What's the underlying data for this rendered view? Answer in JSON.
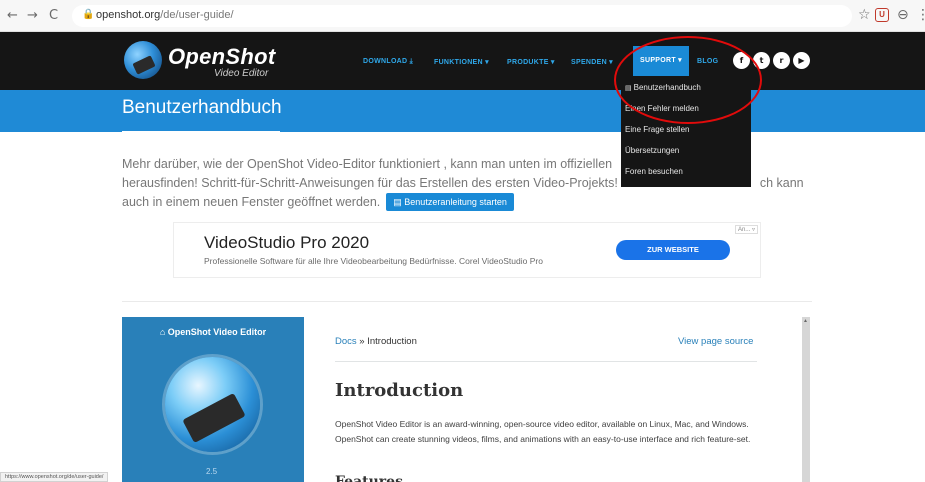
{
  "browser": {
    "back": "←",
    "forward": "→",
    "reload": "C",
    "lock": "🔒",
    "url_host": "openshot.org",
    "url_path": "/de/user-guide/",
    "star": "☆",
    "ext_label": "U",
    "profile": "⊖",
    "menu": "⋮"
  },
  "header": {
    "logo_word": "OpenShot",
    "logo_sub": "Video Editor",
    "nav": [
      {
        "label": "DOWNLOAD ⤓"
      },
      {
        "label": "FUNKTIONEN ▾"
      },
      {
        "label": "PRODUKTE ▾"
      },
      {
        "label": "SPENDEN ▾"
      },
      {
        "label": "SUPPORT ▾"
      },
      {
        "label": "BLOG"
      }
    ],
    "social": [
      "f",
      "t",
      "r",
      "▶"
    ]
  },
  "banner": {
    "title": "Benutzerhandbuch"
  },
  "intro": {
    "line1": "Mehr darüber, wie der OpenShot Video-Editor funktioniert , kann man unten im offiziellen",
    "line2_start": "herausfinden! Schritt-für-Schritt-Anweisungen für das Erstellen des ersten Video-Projekts!",
    "line2_end": "ch kann",
    "line3": "auch in einem neuen Fenster geöffnet werden.",
    "button": "Benutzeranleitung starten"
  },
  "ad": {
    "title": "VideoStudio Pro 2020",
    "subtitle": "Professionelle Software für alle Ihre Videobearbeitung Bedürfnisse. Corel VideoStudio Pro",
    "button": "ZUR WEBSITE",
    "choice": "An... ▿"
  },
  "docs": {
    "sidebar_title": "OpenShot Video Editor",
    "home_icon": "⌂",
    "version": "2.5",
    "crumb_link": "Docs",
    "crumb_sep": "»",
    "crumb_current": "Introduction",
    "view_source": "View page source",
    "heading": "Introduction",
    "paragraph": "OpenShot Video Editor is an award-winning, open-source video editor, available on Linux, Mac, and Windows. OpenShot can create stunning videos, films, and animations with an easy-to-use interface and rich feature-set.",
    "next_heading": "Features"
  },
  "dropdown": {
    "items": [
      {
        "label": "Benutzerhandbuch"
      },
      {
        "label": "Einen Fehler melden"
      },
      {
        "label": "Eine Frage stellen"
      },
      {
        "label": "Übersetzungen"
      },
      {
        "label": "Foren besuchen"
      }
    ]
  },
  "status_bar": {
    "text": "https://www.openshot.org/de/user-guide/"
  },
  "colors": {
    "accent": "#1f8ad6",
    "header_bg": "#151515",
    "annotation": "#e10b0b"
  }
}
